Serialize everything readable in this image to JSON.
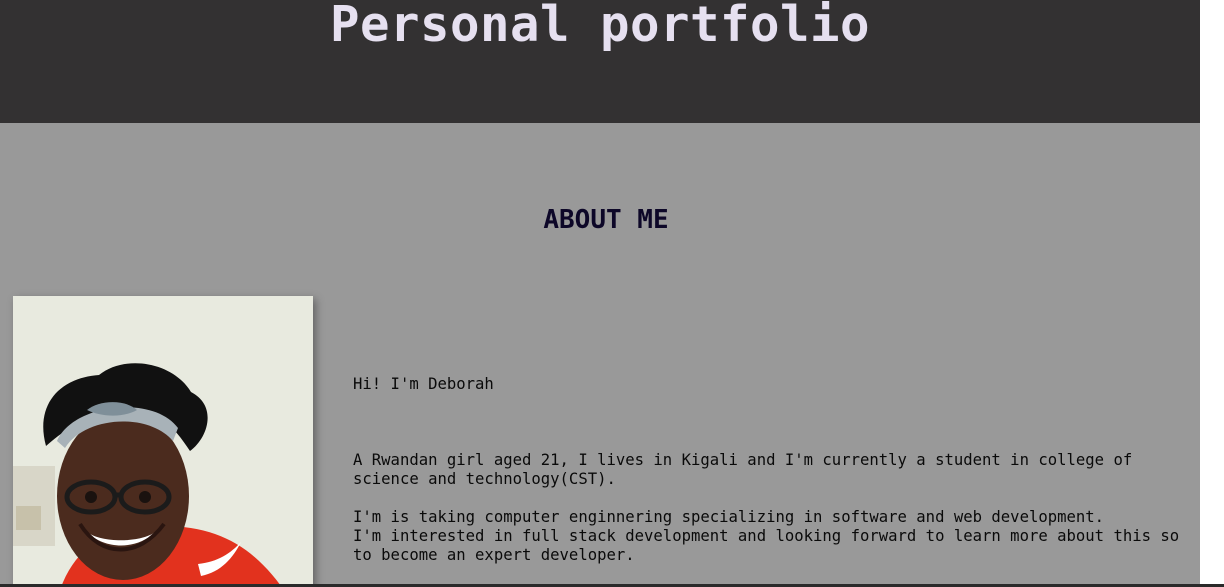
{
  "header": {
    "title": "Personal portfolio"
  },
  "about": {
    "heading": "ABOUT ME",
    "greeting": "Hi! I'm Deborah",
    "paragraph_1": "A Rwandan girl aged 21, I lives in Kigali and I'm currently a student in college of science and technology(CST).",
    "paragraph_2_line_1": "I'm is taking computer enginnering specializing in software and web development.",
    "paragraph_2_line_2": "I'm interested in full stack development and looking forward to learn more about this so to become an expert developer."
  },
  "photo": {
    "subject": "profile-photo-of-deborah"
  },
  "colors": {
    "header_background": "#333132",
    "title_text": "#e6e0f0",
    "section_background": "#999999",
    "heading_text": "#0d0728",
    "body_text": "#0a0a0a"
  }
}
